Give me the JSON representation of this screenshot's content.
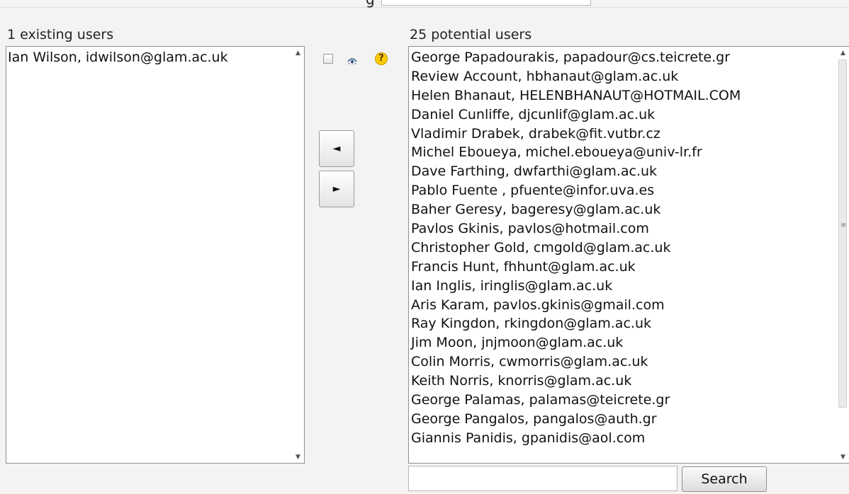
{
  "existing": {
    "heading": "1 existing users",
    "users": [
      "Ian Wilson, idwilson@glam.ac.uk"
    ]
  },
  "potential": {
    "heading": "25 potential users",
    "users": [
      "George Papadourakis, papadour@cs.teicrete.gr",
      "Review Account, hbhanaut@glam.ac.uk",
      "Helen Bhanaut, HELENBHANAUT@HOTMAIL.COM",
      "Daniel Cunliffe, djcunlif@glam.ac.uk",
      "Vladimir Drabek, drabek@fit.vutbr.cz",
      "Michel Eboueya, michel.eboueya@univ-lr.fr",
      "Dave Farthing, dwfarthi@glam.ac.uk",
      "Pablo Fuente , pfuente@infor.uva.es",
      "Baher Geresy, bageresy@glam.ac.uk",
      "Pavlos Gkinis, pavlos@hotmail.com",
      "Christopher Gold, cmgold@glam.ac.uk",
      "Francis Hunt, fhhunt@glam.ac.uk",
      "Ian Inglis, iringlis@glam.ac.uk",
      "Aris Karam, pavlos.gkinis@gmail.com",
      "Ray Kingdon, rkingdon@glam.ac.uk",
      "Jim Moon, jnjmoon@glam.ac.uk",
      "Colin Morris, cwmorris@glam.ac.uk",
      "Keith Norris, knorris@glam.ac.uk",
      "George Palamas, palamas@teicrete.gr",
      "George Pangalos, pangalos@auth.gr",
      "Giannis Panidis, gpanidis@aol.com"
    ]
  },
  "controls": {
    "add_arrow": "◄",
    "remove_arrow": "►",
    "help_glyph": "?"
  },
  "search": {
    "button_label": "Search",
    "value": ""
  },
  "top_fragment": {
    "glyph": "g"
  },
  "icons": {
    "eye": "eye-icon",
    "help": "help-icon",
    "scroll_up": "triangle-up-icon",
    "scroll_down": "triangle-down-icon"
  },
  "colors": {
    "background": "#f3f3f3",
    "help_icon": "#ffcc00",
    "eye_icon": "#3a5a86"
  }
}
